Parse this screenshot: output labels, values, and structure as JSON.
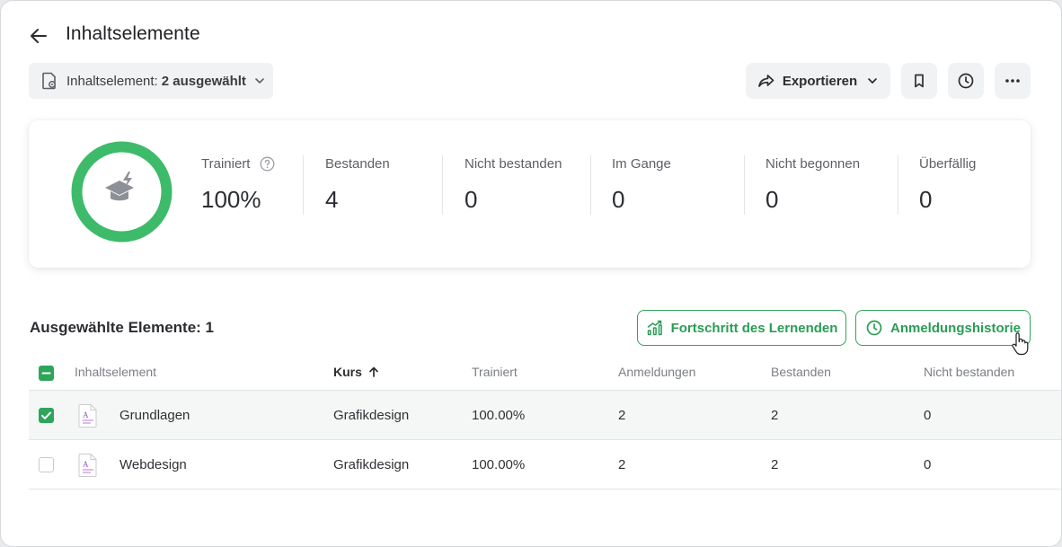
{
  "header": {
    "title": "Inhaltselemente"
  },
  "filter": {
    "label": "Inhaltselement:",
    "value": "2 ausgewählt"
  },
  "toolbar": {
    "export_label": "Exportieren"
  },
  "stats": [
    {
      "label": "Trainiert",
      "value": "100%"
    },
    {
      "label": "Bestanden",
      "value": "4"
    },
    {
      "label": "Nicht bestanden",
      "value": "0"
    },
    {
      "label": "Im Gange",
      "value": "0"
    },
    {
      "label": "Nicht begonnen",
      "value": "0"
    },
    {
      "label": "Überfällig",
      "value": "0"
    }
  ],
  "colors": {
    "accent": "#2ea55a",
    "ring": "#3dbb6a",
    "icon": "#8d9096"
  },
  "selection": {
    "title": "Ausgewählte Elemente: 1",
    "progress_button": "Fortschritt des Lernenden",
    "history_button": "Anmeldungshistorie"
  },
  "table": {
    "columns": [
      "Inhaltselement",
      "Kurs",
      "Trainiert",
      "Anmeldungen",
      "Bestanden",
      "Nicht bestanden"
    ],
    "rows": [
      {
        "checked": true,
        "name": "Grundlagen",
        "course": "Grafikdesign",
        "trained": "100.00%",
        "enrollments": "2",
        "passed": "2",
        "failed": "0"
      },
      {
        "checked": false,
        "name": "Webdesign",
        "course": "Grafikdesign",
        "trained": "100.00%",
        "enrollments": "2",
        "passed": "2",
        "failed": "0"
      }
    ]
  }
}
